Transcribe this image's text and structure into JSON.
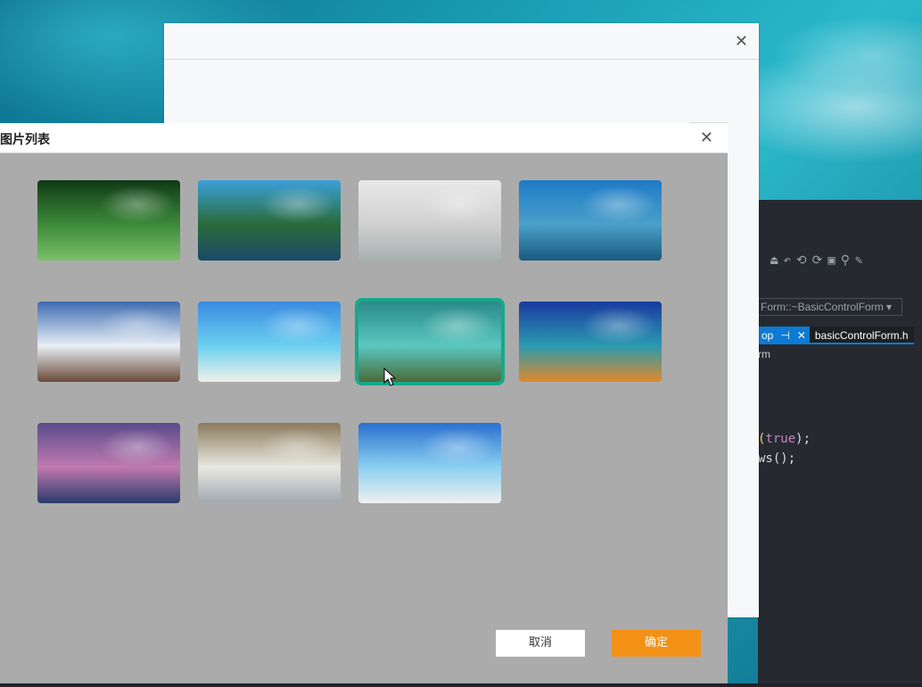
{
  "back_window": {
    "close_glyph": "✕"
  },
  "ide": {
    "toolbar_glyphs": "⏏↶⟲⟳▣⚲✎",
    "member_combo": "Form::~BasicControlForm",
    "combo_arrow": "▾",
    "tab_active_label": "op",
    "tab_pin": "⊣",
    "tab_close": "✕",
    "tab_file": "basicControlForm.h",
    "nav_text": "rm",
    "code_line1_paren_open": "(",
    "code_line1_kw": "true",
    "code_line1_rest": ");",
    "code_line2": "ws();"
  },
  "dialog": {
    "title": "图片列表",
    "close_glyph": "✕",
    "cancel_label": "取消",
    "ok_label": "确定",
    "selected_index": 6,
    "images": [
      {
        "name": "water-drops-leaf",
        "colors": [
          "#0f3a16",
          "#3c8a3a",
          "#7cc06a"
        ]
      },
      {
        "name": "coastal-cliff-temple",
        "colors": [
          "#3aa0d8",
          "#2a6a3a",
          "#1a4a6a"
        ]
      },
      {
        "name": "white-interior-desk",
        "colors": [
          "#e8e8e8",
          "#d0d0d0",
          "#a8b0b0"
        ]
      },
      {
        "name": "lake-hills",
        "colors": [
          "#1e7ac8",
          "#4aa0c8",
          "#1a5a80"
        ]
      },
      {
        "name": "potala-palace-stupa",
        "colors": [
          "#3d6bb0",
          "#e8eef5",
          "#6a4a3a"
        ]
      },
      {
        "name": "white-sand-beach",
        "colors": [
          "#3a8ae0",
          "#6ad0f0",
          "#f0f0e8"
        ]
      },
      {
        "name": "aerial-island-runway",
        "colors": [
          "#2a8a8a",
          "#5ac8c0",
          "#4a6a3a"
        ]
      },
      {
        "name": "orange-sand-cove",
        "colors": [
          "#1a3aa0",
          "#2a9ab0",
          "#e08a2a"
        ]
      },
      {
        "name": "mountain-lake-sunset",
        "colors": [
          "#5a4a8a",
          "#c07ab0",
          "#2a3a6a"
        ]
      },
      {
        "name": "winter-tree-river",
        "colors": [
          "#8a7a5a",
          "#e8e8e0",
          "#a0a8b0"
        ]
      },
      {
        "name": "tropical-beach-sky",
        "colors": [
          "#2a70d0",
          "#8ad0f0",
          "#f0f0f0"
        ]
      }
    ]
  },
  "cursor": {
    "name": "mouse-pointer-icon"
  }
}
